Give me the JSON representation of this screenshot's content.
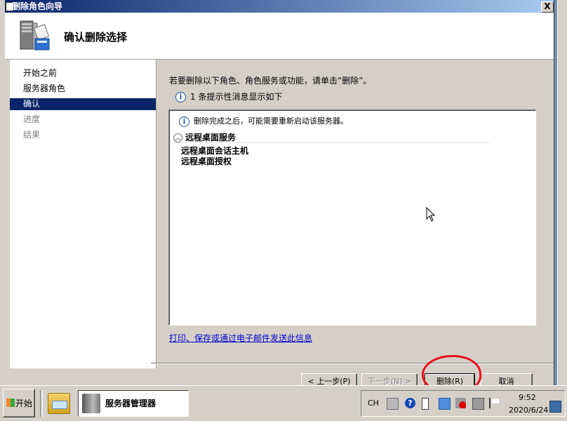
{
  "window": {
    "title": "删除角色向导",
    "close_glyph": "X",
    "heading": "确认删除选择"
  },
  "sidebar": {
    "items": [
      {
        "label": "开始之前",
        "state": "normal"
      },
      {
        "label": "服务器角色",
        "state": "normal"
      },
      {
        "label": "确认",
        "state": "selected"
      },
      {
        "label": "进度",
        "state": "disabled"
      },
      {
        "label": "结果",
        "state": "disabled"
      }
    ]
  },
  "main": {
    "instruction": "若要删除以下角色、角色服务或功能，请单击“删除”。",
    "info_count": "1 条提示性消息显示如下",
    "info_glyph": "i",
    "list": {
      "note": "删除完成之后，可能需要重新启动该服务器。",
      "section_title": "远程桌面服务",
      "items": [
        "远程桌面会话主机",
        "远程桌面授权"
      ]
    },
    "link": "打印、保存或通过电子邮件发送此信息"
  },
  "buttons": {
    "prev": "< 上一步(P)",
    "next": "下一步(N) >",
    "delete": "删除(R)",
    "cancel": "取消"
  },
  "annotation": {
    "color": "#e8101c",
    "target": "delete-button"
  },
  "taskbar": {
    "start_label": "开始",
    "active_task": "服务器管理器",
    "language": "CH",
    "help_glyph": "?",
    "time": "9:52",
    "date": "2020/6/24"
  },
  "colors": {
    "selection": "#0a246a",
    "link": "#0000cc",
    "face": "#d4d0c8"
  }
}
